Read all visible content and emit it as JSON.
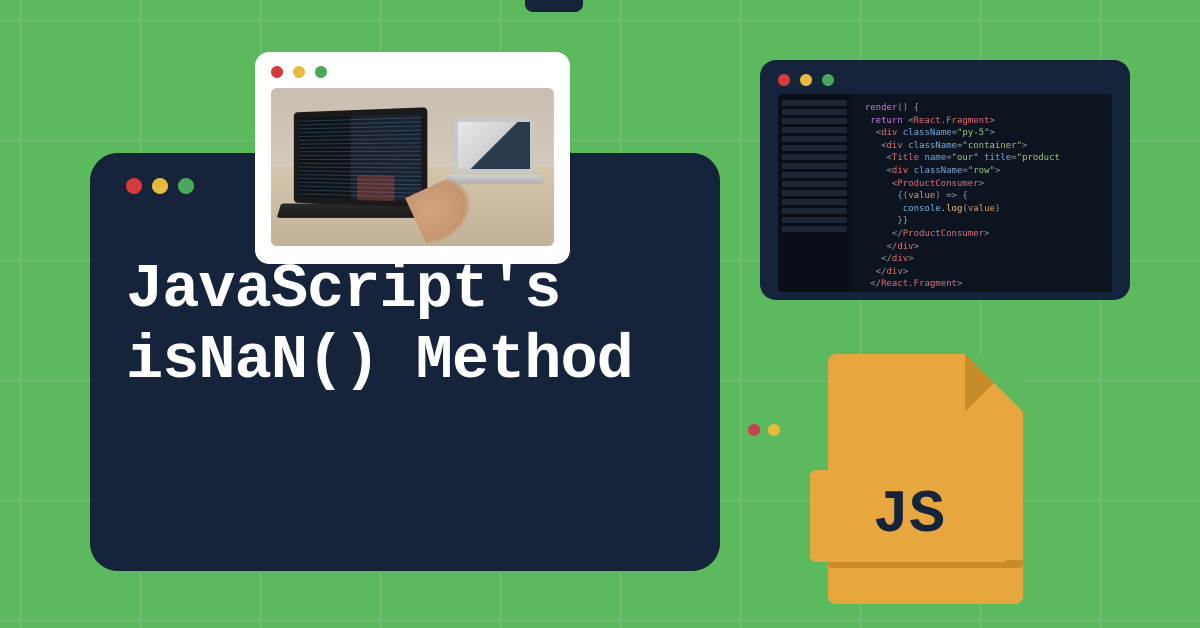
{
  "main": {
    "title": "JavaScript's isNaN() Method"
  },
  "jsfile": {
    "label": "JS"
  },
  "code": {
    "line1_kw": "render",
    "line1_rest": "() {",
    "line2_kw": "return",
    "line2_tag": "React.Fragment",
    "line3_tag": "div",
    "line3_attr": "className",
    "line3_val": "\"py-5\"",
    "line4_tag": "div",
    "line4_attr": "className",
    "line4_val": "\"container\"",
    "line5_tag": "Title",
    "line5_attr1": "name",
    "line5_val1": "\"our\"",
    "line5_attr2": "title",
    "line5_val2": "\"product",
    "line6_tag": "div",
    "line6_attr": "className",
    "line6_val": "\"row\"",
    "line7_tag": "ProductConsumer",
    "line8_open": "{(",
    "line8_var": "value",
    "line8_arrow": ") => {",
    "line9_fn": "console.",
    "line9_log": "log",
    "line9_open": "(",
    "line9_var": "value",
    "line9_close": ")",
    "line10": "}}",
    "line11_tag": "ProductConsumer",
    "line12_tag": "div",
    "line13_tag": "div",
    "line14_tag": "div",
    "line15_tag": "React.Fragment"
  },
  "colors": {
    "bg": "#5cb95e",
    "card": "#15243a",
    "accent": "#e8a63f"
  }
}
